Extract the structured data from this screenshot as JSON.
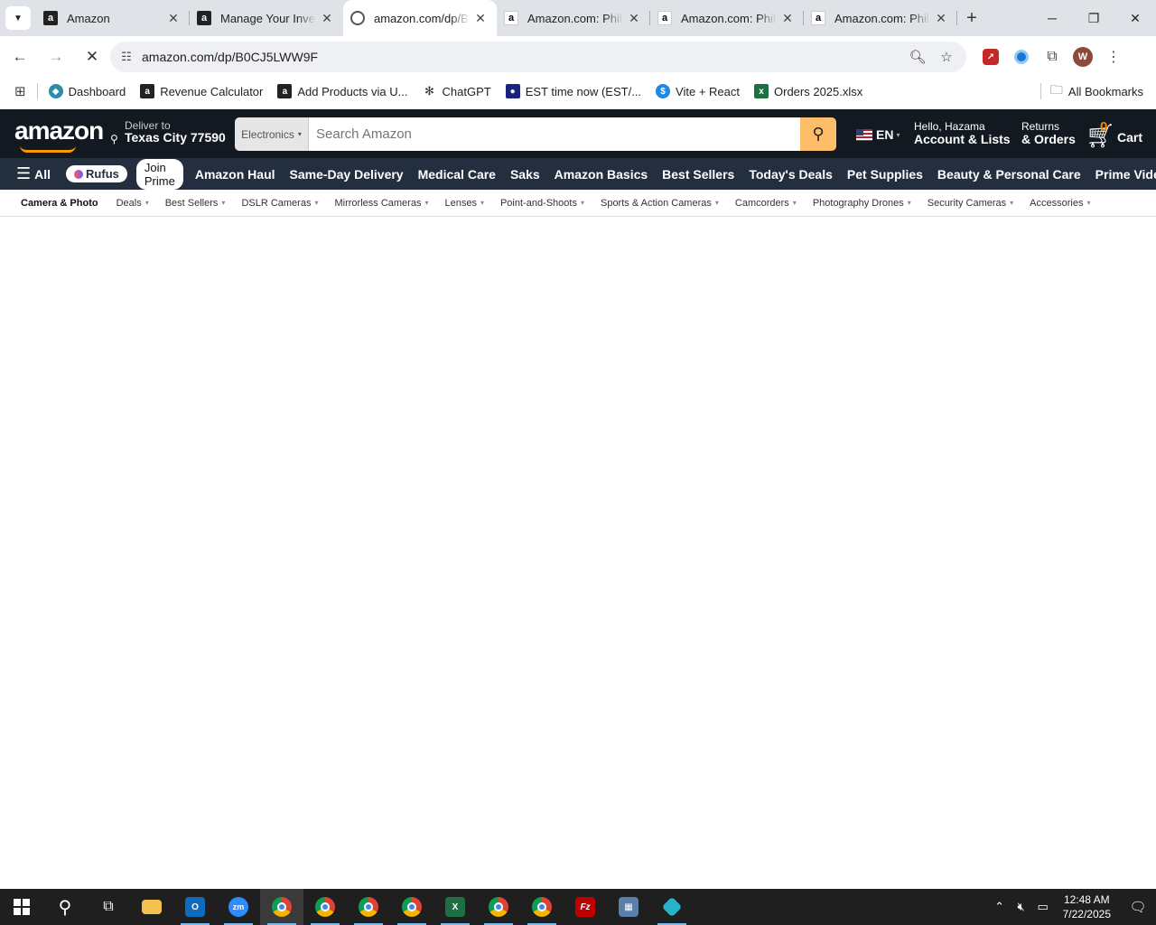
{
  "browser": {
    "tab_list_icon": "chevron-down-icon",
    "tabs": [
      {
        "title": "Amazon",
        "favicon": "amazon-a",
        "active": false
      },
      {
        "title": "Manage Your Inve",
        "favicon": "amazon-a",
        "active": false
      },
      {
        "title": "amazon.com/dp/B",
        "favicon": "loading-ring",
        "active": true
      },
      {
        "title": "Amazon.com: Phil",
        "favicon": "amazon-a-light",
        "active": false
      },
      {
        "title": "Amazon.com: Phil",
        "favicon": "amazon-a-light",
        "active": false
      },
      {
        "title": "Amazon.com: Phil",
        "favicon": "amazon-a-light",
        "active": false
      }
    ],
    "new_tab": "+",
    "window_controls": {
      "minimize": "─",
      "restore": "❐",
      "close": "✕"
    },
    "address_bar": {
      "url": "amazon.com/dp/B0CJ5LWW9F"
    },
    "profile_initial": "W",
    "bookmarks": [
      {
        "label": "Dashboard",
        "icon_color": "#2d8ca8",
        "glyph": "◆"
      },
      {
        "label": "Revenue Calculator",
        "icon_color": "#222222",
        "glyph": "a"
      },
      {
        "label": "Add Products via U...",
        "icon_color": "#222222",
        "glyph": "a"
      },
      {
        "label": "ChatGPT",
        "icon_color": "#ffffff",
        "glyph": "✻"
      },
      {
        "label": "EST time now (EST/...",
        "icon_color": "#1a237e",
        "glyph": "●"
      },
      {
        "label": "Vite + React",
        "icon_color": "#1e88e5",
        "glyph": "$"
      },
      {
        "label": "Orders 2025.xlsx",
        "icon_color": "#1d6f42",
        "glyph": "x"
      }
    ],
    "all_bookmarks": "All Bookmarks"
  },
  "amazon": {
    "logo": "amazon",
    "deliver_line1": "Deliver to",
    "deliver_line2": "Texas City 77590",
    "search_category": "Electronics",
    "search_placeholder": "Search Amazon",
    "language": "EN",
    "account_line1": "Hello, Hazama",
    "account_line2": "Account & Lists",
    "returns_line1": "Returns",
    "returns_line2": "& Orders",
    "cart_count": "0",
    "cart_label": "Cart",
    "nav_all": "All",
    "rufus": "Rufus",
    "join_prime": "Join Prime",
    "nav_items": [
      "Amazon Haul",
      "Same-Day Delivery",
      "Medical Care",
      "Saks",
      "Amazon Basics",
      "Best Sellers",
      "Today's Deals",
      "Pet Supplies",
      "Beauty & Personal Care",
      "Prime Video"
    ],
    "category_title": "Camera & Photo",
    "category_items": [
      "Deals",
      "Best Sellers",
      "DSLR Cameras",
      "Mirrorless Cameras",
      "Lenses",
      "Point-and-Shoots",
      "Sports & Action Cameras",
      "Camcorders",
      "Photography Drones",
      "Security Cameras",
      "Accessories"
    ]
  },
  "taskbar": {
    "time": "12:48 AM",
    "date": "7/22/2025"
  },
  "colors": {
    "amazon_dark": "#131921",
    "amazon_nav": "#232f3e",
    "search_button": "#febd69",
    "cart_count": "#f08804"
  }
}
